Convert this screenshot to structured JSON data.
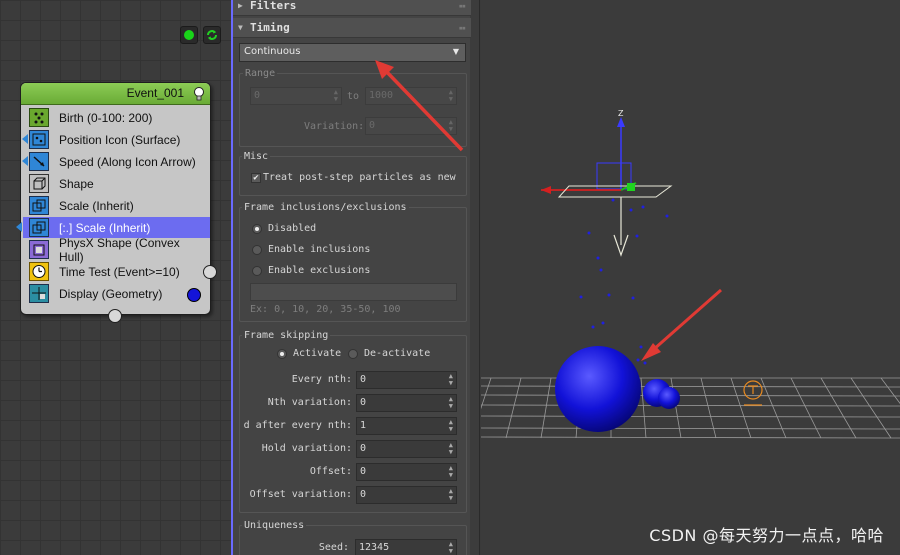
{
  "graph": {
    "event_title": "Event_001",
    "operators": [
      {
        "label": "Birth (0-100: 200)",
        "icon": "birth-icon"
      },
      {
        "label": "Position Icon (Surface)",
        "icon": "position-icon"
      },
      {
        "label": "Speed (Along Icon Arrow)",
        "icon": "speed-icon"
      },
      {
        "label": "Shape",
        "icon": "shape-icon"
      },
      {
        "label": "Scale (Inherit)",
        "icon": "scale-icon"
      },
      {
        "label": "[:.] Scale (Inherit)",
        "icon": "scale-icon",
        "selected": true
      },
      {
        "label": "PhysX Shape (Convex Hull)",
        "icon": "physx-shape-icon"
      },
      {
        "label": "Time Test (Event>=10)",
        "icon": "time-test-icon"
      },
      {
        "label": "Display (Geometry)",
        "icon": "display-icon"
      }
    ],
    "accent": "#6c6cf0"
  },
  "panel": {
    "rollouts": {
      "filters": "Filters",
      "timing": "Timing"
    },
    "timing": {
      "mode": "Continuous",
      "range_label": "Range",
      "range_from": "0",
      "to_label": "to",
      "range_to": "1000",
      "variation_label": "Variation:",
      "variation_value": "0"
    },
    "misc": {
      "title": "Misc",
      "treat_label": "Treat post-step particles as new",
      "treat_checked": true
    },
    "frame_inclusions": {
      "title": "Frame inclusions/exclusions",
      "options": [
        "Disabled",
        "Enable inclusions",
        "Enable exclusions"
      ],
      "selected": "Disabled",
      "example": "Ex: 0, 10, 20, 35-50, 100"
    },
    "frame_skipping": {
      "title": "Frame skipping",
      "activate": "Activate",
      "deactivate": "De-activate",
      "fields": [
        {
          "label": "Every nth:",
          "value": "0"
        },
        {
          "label": "Nth variation:",
          "value": "0"
        },
        {
          "label": "d after every nth:",
          "value": "1"
        },
        {
          "label": "Hold variation:",
          "value": "0"
        },
        {
          "label": "Offset:",
          "value": "0"
        },
        {
          "label": "Offset variation:",
          "value": "0"
        }
      ]
    },
    "uniqueness": {
      "title": "Uniqueness",
      "seed_label": "Seed:",
      "seed_value": "12345"
    }
  },
  "viewport": {
    "axis_label_z": "Z",
    "watermark": "CSDN @每天努力一点点，哈哈"
  },
  "colors": {
    "arrow_annotation": "#e03a34",
    "particle_blue": "#1a1ae0",
    "selection": "#6c6cf0",
    "event_header": "#7cbc46"
  }
}
